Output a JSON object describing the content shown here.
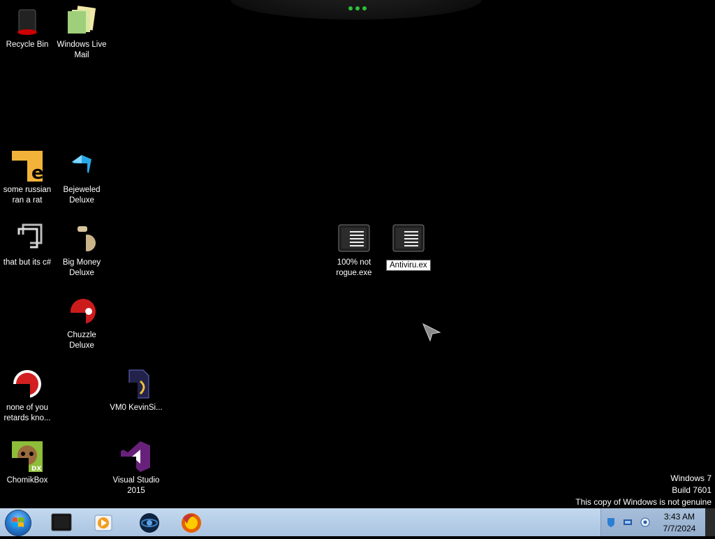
{
  "desktop": {
    "icons": [
      {
        "label": "Recycle Bin",
        "icon": "recycle-bin-icon"
      },
      {
        "label": "Windows Live Mail",
        "icon": "mail-icon"
      },
      {
        "label": "some russian ran a rat",
        "icon": "program-icon"
      },
      {
        "label": "Bejeweled Deluxe",
        "icon": "gem-icon"
      },
      {
        "label": "that but its c#",
        "icon": "windows-icon"
      },
      {
        "label": "Big Money Deluxe",
        "icon": "money-icon"
      },
      {
        "label": "Chuzzle Deluxe",
        "icon": "chuzzle-icon"
      },
      {
        "label": "none of you retards kno...",
        "icon": "circle-icon"
      },
      {
        "label": "VM0 KevinSi...",
        "icon": "file-icon"
      },
      {
        "label": "ChomikBox",
        "icon": "hamster-icon"
      },
      {
        "label": "Visual Studio 2015",
        "icon": "visual-studio-icon"
      },
      {
        "label": "100% not rogue.exe",
        "icon": "exe-icon"
      }
    ],
    "renaming": {
      "value": "Antiviru.exe",
      "icon": "exe-icon"
    }
  },
  "watermark": {
    "line1": "Windows 7",
    "line2": "Build 7601",
    "line3": "This copy of Windows is not genuine"
  },
  "taskbar": {
    "pinned": [
      {
        "name": "explorer",
        "icon": "window-icon"
      },
      {
        "name": "media-player",
        "icon": "media-player-icon"
      },
      {
        "name": "app",
        "icon": "globe-icon"
      },
      {
        "name": "firefox",
        "icon": "firefox-icon"
      }
    ],
    "clock": {
      "time": "3:43 AM",
      "date": "7/7/2024"
    }
  },
  "colors": {
    "desktop_bg": "#000000",
    "taskbar_bg": "#b7cfea",
    "accent": "#2a7fd4"
  }
}
